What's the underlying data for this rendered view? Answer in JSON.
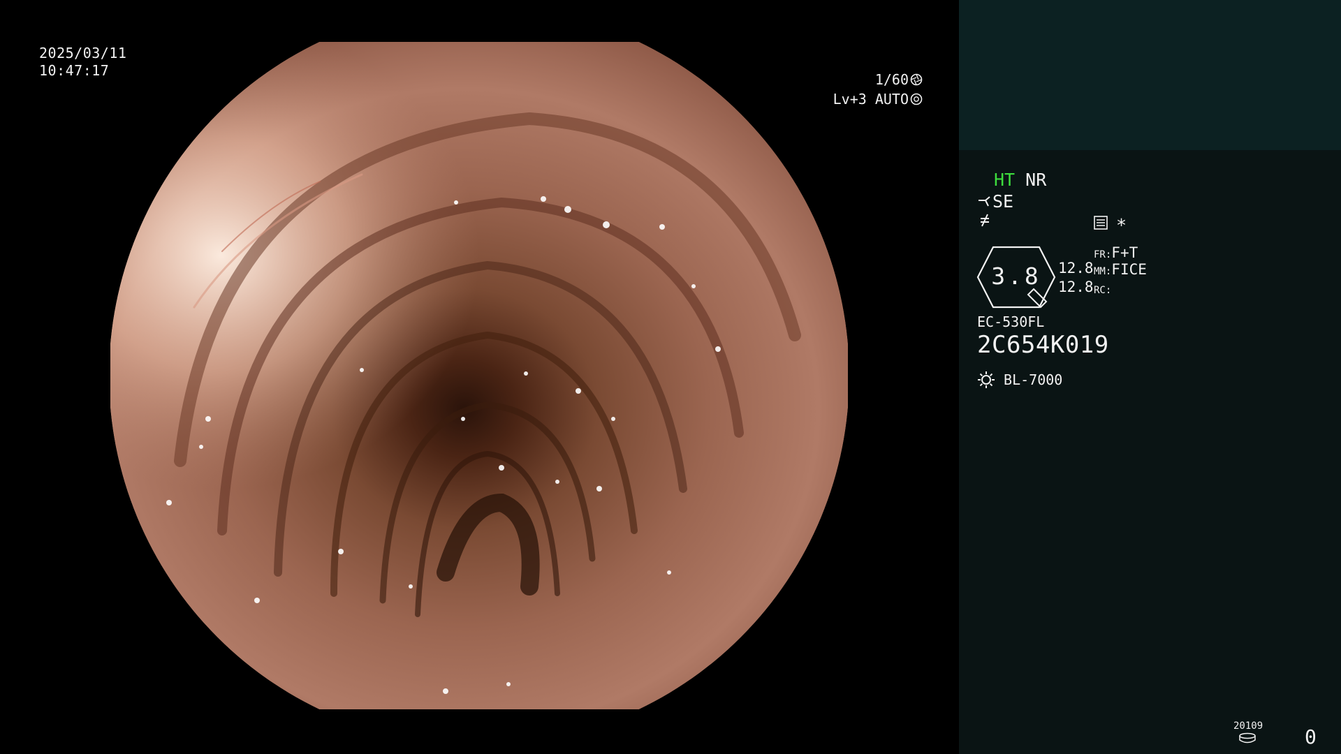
{
  "overlay": {
    "date": "2025/03/11",
    "time": "10:47:17",
    "shutter": "1/60",
    "shutter_icon": "aperture-icon",
    "exposure": "Lv+3 AUTO",
    "exposure_icon": "iris-icon"
  },
  "panel": {
    "ht_label": "HT",
    "nr_label": "NR",
    "se_label": "SE",
    "se_icon": "scope-icon",
    "slash_icon": "not-equal-icon",
    "record_icon": "memo-icon",
    "asterisk": "*",
    "gauge_value": "3.8",
    "gauge_val_top": "12.8",
    "gauge_val_bottom": "12.8",
    "fr_label": "FR:",
    "fr_value": "F+T",
    "mm_label": "MM:",
    "mm_value": "FICE",
    "rc_label": "RC:",
    "scope_model": "EC-530FL",
    "scope_serial": "2C654K019",
    "light_icon": "light-source-icon",
    "light_source": "BL-7000",
    "footer_code": "20109",
    "footer_icon": "storage-icon",
    "footer_count": "0",
    "colors": {
      "background": "#0a1414",
      "thumb_area": "#0c2122",
      "highlight": "#3ddc3d",
      "text": "#f2f2f2"
    }
  }
}
